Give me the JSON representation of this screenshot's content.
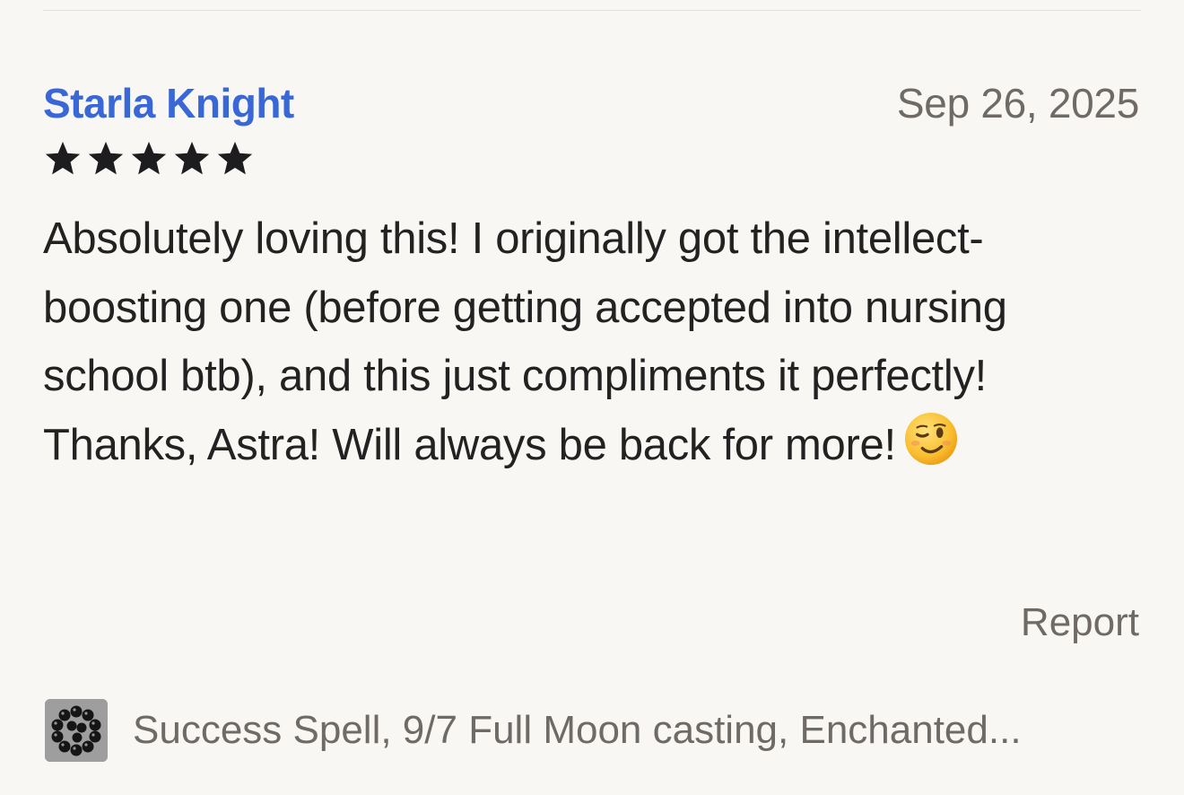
{
  "review": {
    "reviewer_name": "Starla Knight",
    "date": "Sep 26, 2025",
    "rating": 5,
    "rating_max": 5,
    "text": "Absolutely loving this! I originally got the intellect-boosting one (before getting accepted into nursing school btb), and this just compliments it perfectly! Thanks, Astra! Will always be back for more!",
    "emoji": "winking-face-icon"
  },
  "actions": {
    "report_label": "Report"
  },
  "item": {
    "thumbnail": "bead-bracelet-image",
    "title": "Success Spell, 9/7 Full Moon casting, Enchanted..."
  },
  "colors": {
    "accent": "#3a67d6",
    "muted": "#6f6a66",
    "background": "#f8f7f4"
  }
}
